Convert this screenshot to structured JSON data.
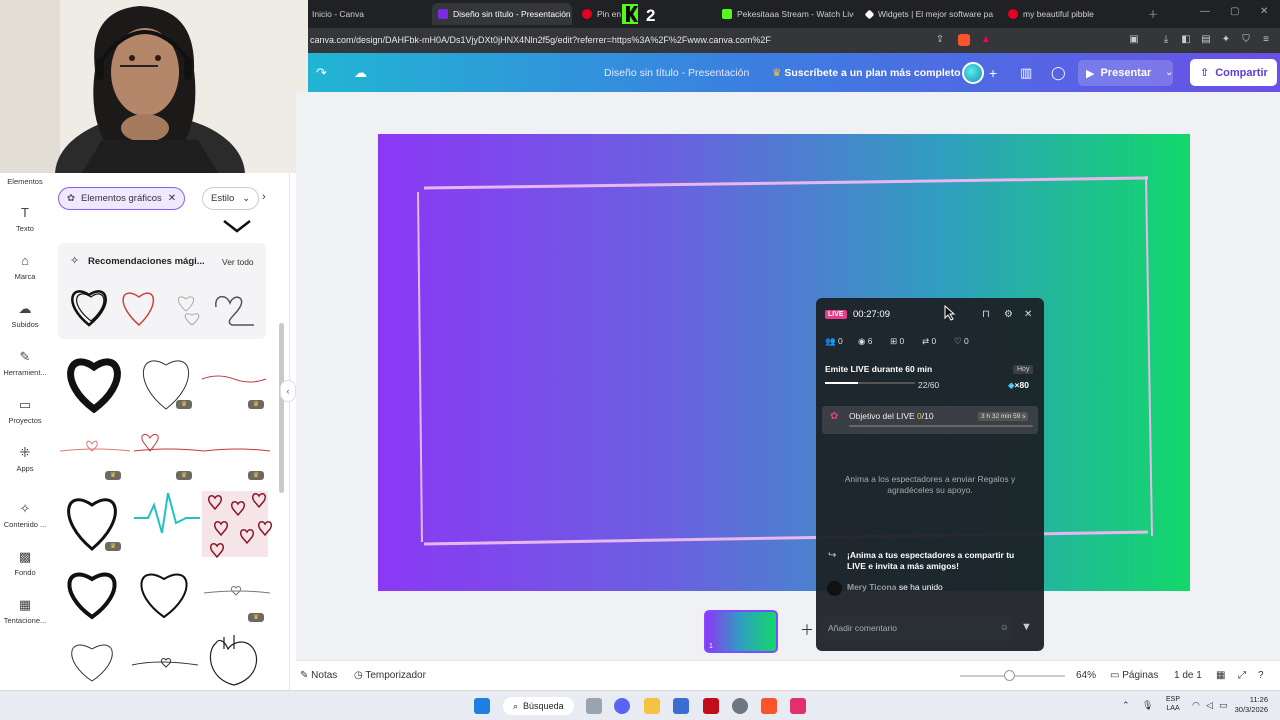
{
  "browser": {
    "tabs": [
      {
        "label": "Inicio - Canva",
        "color": "#7d2ae8"
      },
      {
        "label": "Diseño sin título - Presentación",
        "color": "#7d2ae8",
        "active": true
      },
      {
        "label": "Pin en",
        "color": "#e60023"
      },
      {
        "label": "Pekesitaaa Stream - Watch Live",
        "color": "#53fc18"
      },
      {
        "label": "Widgets | El mejor software pa",
        "color": "#ffffff"
      },
      {
        "label": "my beautiful pibble",
        "color": "#e60023"
      }
    ],
    "url": "canva.com/design/DAHFbk-mH0A/Ds1VjyDXt0jHNX4Nln2f5g/edit?referrer=https%3A%2F%2Fwww.canva.com%2F"
  },
  "canva_header": {
    "doc_title": "Diseño sin título - Presentación",
    "upsell": "Suscríbete a un plan más completo",
    "present_label": "Presentar",
    "share_label": "Compartir"
  },
  "left_rail": {
    "items": [
      {
        "label": "Elementos",
        "icon": "shapes-icon"
      },
      {
        "label": "Texto",
        "icon": "text-icon"
      },
      {
        "label": "Marca",
        "icon": "brand-icon"
      },
      {
        "label": "Subidos",
        "icon": "cloud-upload-icon"
      },
      {
        "label": "Herramient...",
        "icon": "pen-icon"
      },
      {
        "label": "Proyectos",
        "icon": "folder-icon"
      },
      {
        "label": "Apps",
        "icon": "apps-icon"
      },
      {
        "label": "Contenido ...",
        "icon": "magic-icon"
      },
      {
        "label": "Fondo",
        "icon": "pattern-icon"
      },
      {
        "label": "Tentacione...",
        "icon": "image-icon"
      }
    ]
  },
  "panel": {
    "chip_label": "Elementos gráficos",
    "style_label": "Estilo",
    "reco_title": "Recomendaciones mági...",
    "reco_all": "Ver todo"
  },
  "live_widget": {
    "badge": "LIVE",
    "time": "00:27:09",
    "stats": {
      "viewers_a": "0",
      "views": "6",
      "gifts": "0",
      "shares": "0",
      "likes": "0"
    },
    "goal_title": "Emite LIVE durante 60 min",
    "goal_today": "Hoy",
    "goal_count": "22/60",
    "goal_progress": 0.367,
    "goal_reward": "×80",
    "objective_prefix": "Objetivo del LIVE ",
    "objective_current": "0",
    "objective_suffix": "/10",
    "objective_time": "3 h 32 min 59 s",
    "hint": "Anima a los espectadores a enviar Regalos y agradéceles su apoyo.",
    "share_msg": "¡Anima a tus espectadores a compartir tu LIVE e invita a más amigos!",
    "join_name": "Mery Ticona",
    "join_text": " se ha unido",
    "comment_placeholder": "Añadir comentario"
  },
  "footer": {
    "notes": "Notas",
    "timer": "Temporizador",
    "zoom": "64%",
    "pages_label": "Páginas",
    "page_count": "1 de 1",
    "thumb_num": "1"
  },
  "taskbar": {
    "search": "Búsqueda",
    "lang": "ESP",
    "lang2": "LAA",
    "time": "11:26",
    "date": "30/3/2026"
  }
}
